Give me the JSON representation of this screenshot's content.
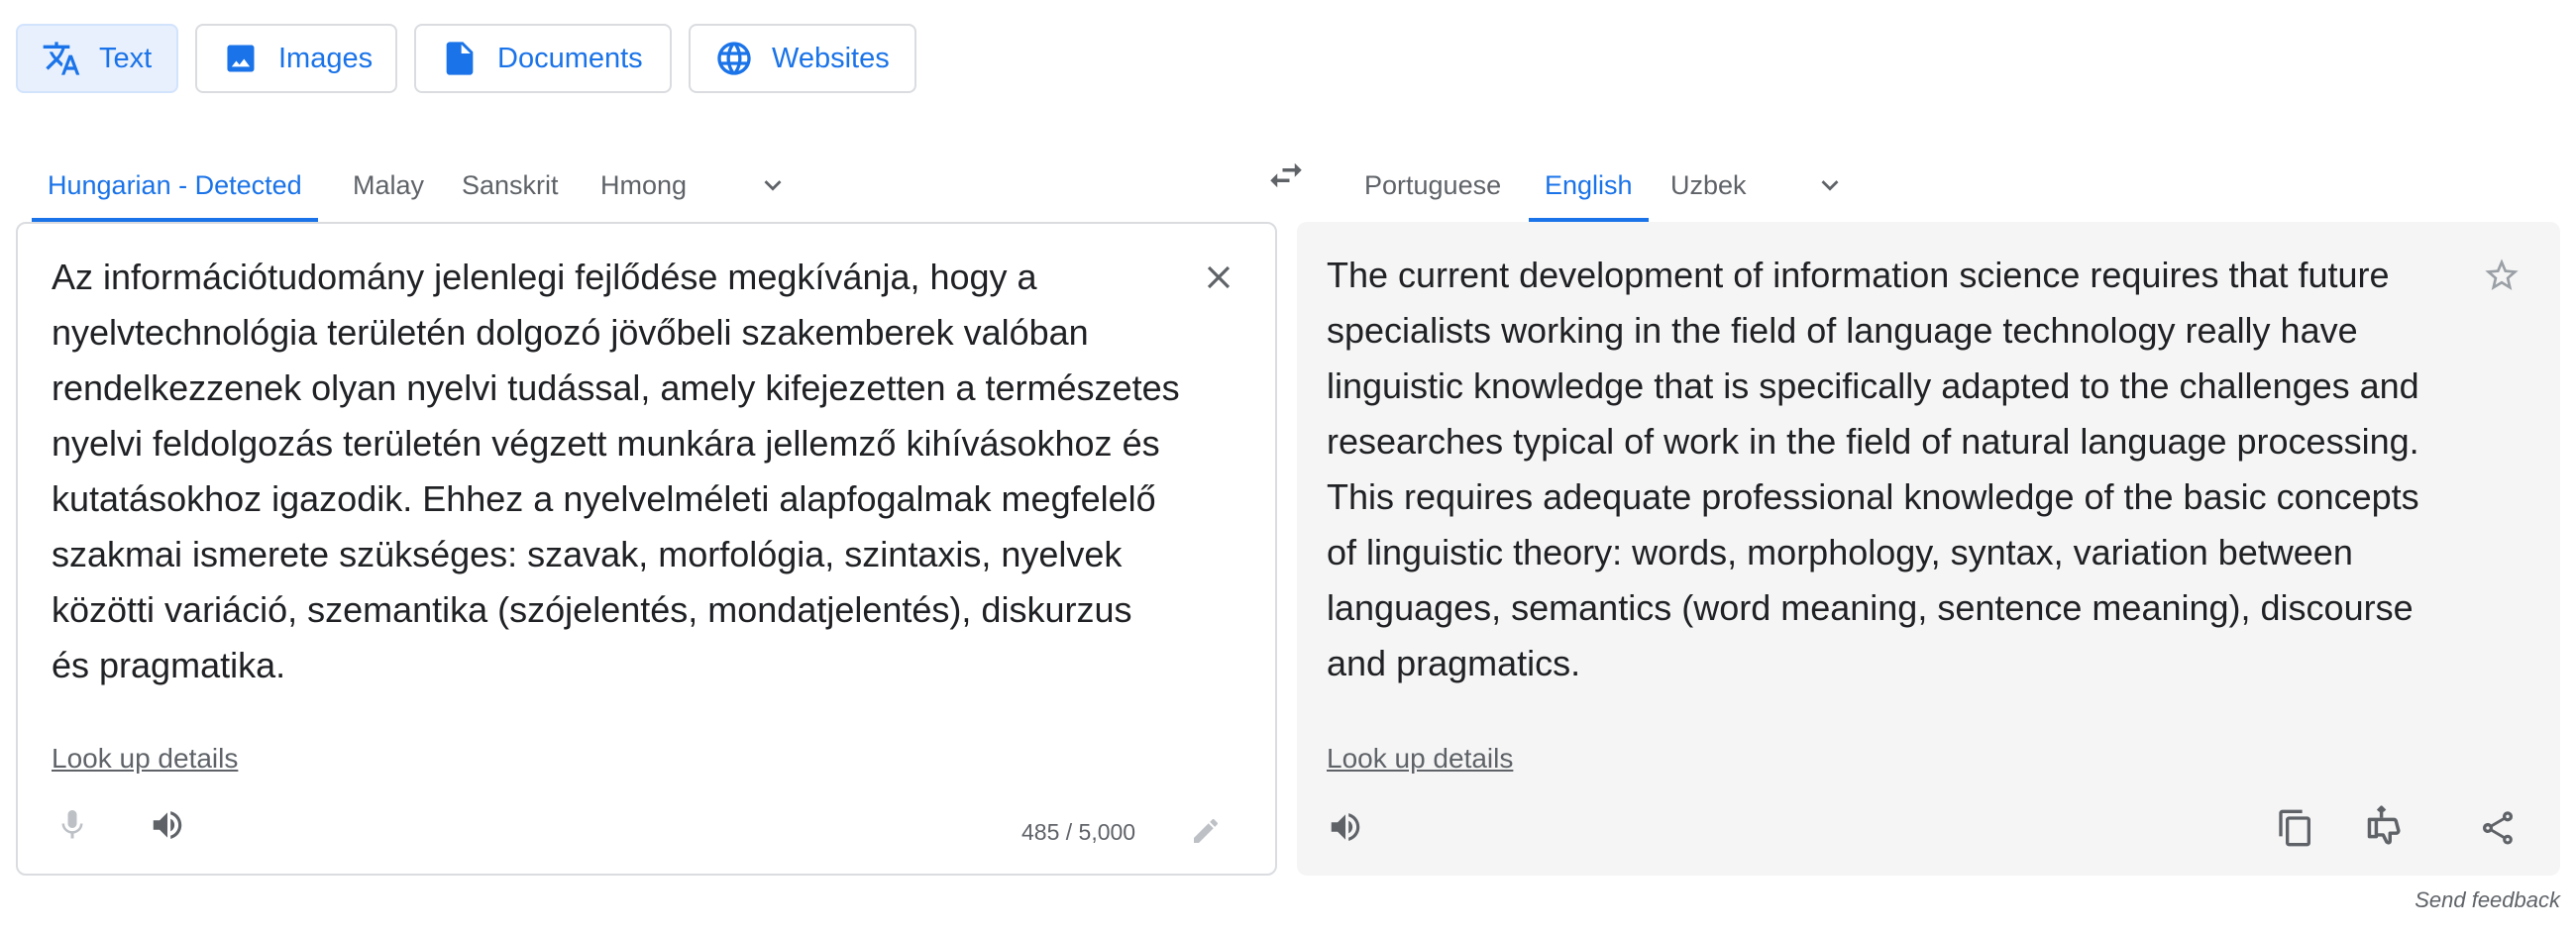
{
  "modes": {
    "text": "Text",
    "images": "Images",
    "documents": "Documents",
    "websites": "Websites"
  },
  "source_languages": [
    "Hungarian - Detected",
    "Malay",
    "Sanskrit",
    "Hmong"
  ],
  "target_languages": [
    "Portuguese",
    "English",
    "Uzbek"
  ],
  "source": {
    "text": "Az információtudomány jelenlegi fejlődése megkívánja, hogy a\nnyelvtechnológia területén dolgozó jövőbeli szakemberek valóban\nrendelkezzenek olyan nyelvi tudással, amely kifejezetten a természetes\nnyelvi feldolgozás területén végzett munkára jellemző kihívásokhoz és\nkutatásokhoz igazodik. Ehhez a nyelvelméleti alapfogalmak megfelelő\nszakmai ismerete szükséges: szavak, morfológia, szintaxis, nyelvek\nközötti variáció, szemantika (szójelentés, mondatjelentés), diskurzus\nés pragmatika.",
    "look_up": "Look up details",
    "char_count": "485 / 5,000"
  },
  "target": {
    "text": "The current development of information science requires that future\nspecialists working in the field of language technology really have\nlinguistic knowledge that is specifically adapted to the challenges and\nresearches typical of work in the field of natural language processing.\nThis requires adequate professional knowledge of the basic concepts\nof linguistic theory: words, morphology, syntax, variation between\nlanguages, semantics (word meaning, sentence meaning), discourse\nand pragmatics.",
    "look_up": "Look up details"
  },
  "send_feedback": "Send feedback",
  "colors": {
    "accent": "#1a73e8",
    "active_bg": "#e8f0fe",
    "text": "#202124",
    "muted": "#5f6368",
    "target_panel_bg": "#f5f5f5"
  },
  "icons": {
    "text_mode": "translate-icon",
    "images_mode": "image-icon",
    "documents_mode": "document-icon",
    "websites_mode": "globe-icon",
    "more_languages": "chevron-down-icon",
    "swap": "swap-icon",
    "clear": "close-icon",
    "mic": "mic-icon",
    "speaker": "speaker-icon",
    "edit": "pencil-icon",
    "star": "star-icon",
    "copy": "copy-icon",
    "rate": "thumbs-rating-icon",
    "share": "share-icon"
  }
}
